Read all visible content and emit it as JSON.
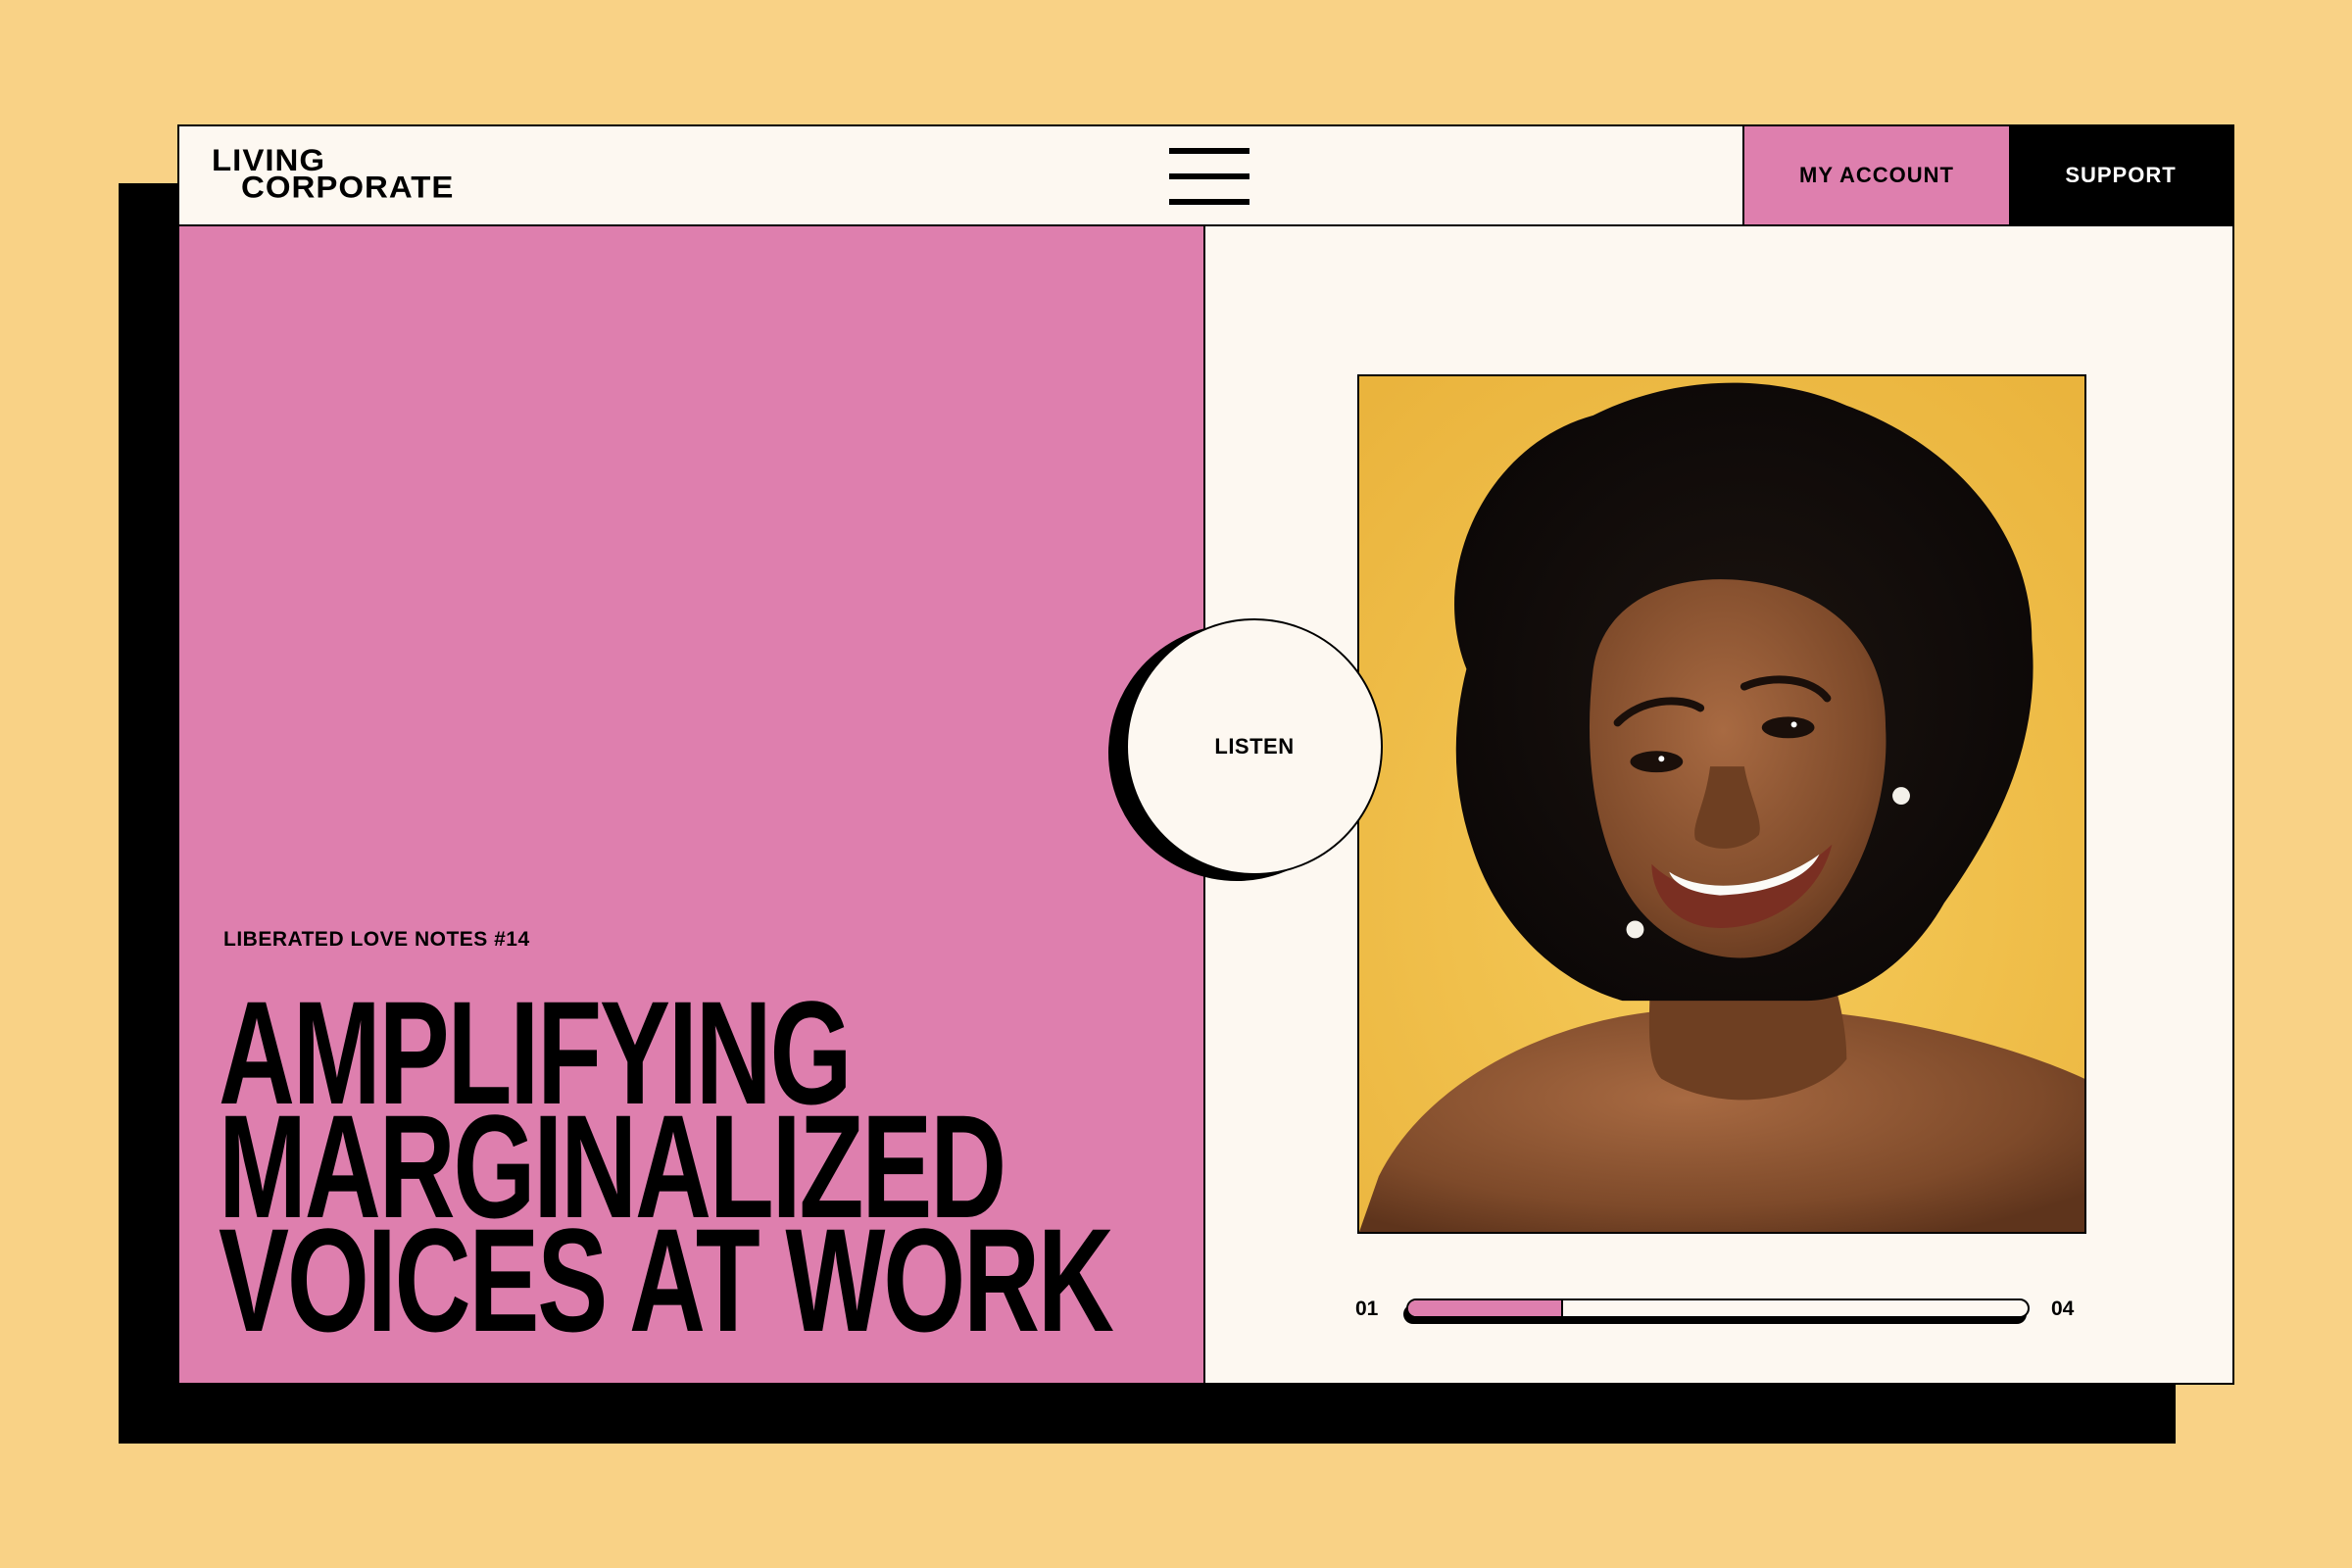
{
  "header": {
    "logo_line1": "LIVING",
    "logo_line2": "CORPORATE",
    "menu_icon": "hamburger-menu-icon",
    "search_icon": "search-icon",
    "account_label": "MY ACCOUNT",
    "support_label": "SUPPORT"
  },
  "hero": {
    "eyebrow": "LIBERATED LOVE NOTES #14",
    "headline_lines": [
      "AMPLIFYING",
      "MARGINALIZED",
      "VOICES AT WORK"
    ],
    "listen_label": "LISTEN",
    "photo_description_icon": "portrait-photo"
  },
  "progress": {
    "start_label": "01",
    "end_label": "04",
    "fraction": 0.25
  },
  "colors": {
    "background": "#f9d286",
    "pink": "#de7fae",
    "cream": "#fdf8f1",
    "black": "#000000",
    "photo_bg": "#f3c24c"
  }
}
